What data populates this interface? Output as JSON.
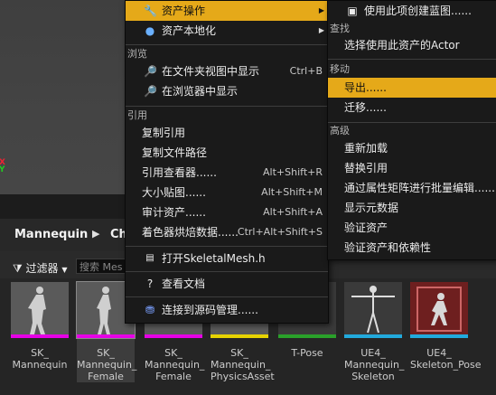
{
  "viewport": {
    "axis_x": "X",
    "axis_y": "Y"
  },
  "breadcrumb": {
    "items": [
      "Mannequin",
      "Ch"
    ]
  },
  "filterbar": {
    "filter_label": "过滤器",
    "search_placeholder": "搜索 Mes"
  },
  "assets": [
    {
      "label": "SK_\nMannequin",
      "bar_color": "#e600e6"
    },
    {
      "label": "SK_\nMannequin_\nFemale",
      "bar_color": "#e600e6"
    },
    {
      "label": "SK_\nMannequin_\nFemale",
      "bar_color": "#e600e6"
    },
    {
      "label": "SK_\nMannequin_\nPhysicsAsset",
      "bar_color": "#e6d200"
    },
    {
      "label": "T-Pose",
      "bar_color": "#2aa02a"
    },
    {
      "label": "UE4_\nMannequin_\nSkeleton",
      "bar_color": "#22aadd"
    },
    {
      "label": "UE4_\nSkeleton_Pose",
      "bar_color": "#22aadd"
    }
  ],
  "main_menu": {
    "asset_actions": "资产操作",
    "asset_localization": "资产本地化",
    "section_browse": "浏览",
    "show_in_folder": "在文件夹视图中显示",
    "show_in_folder_shortcut": "Ctrl+B",
    "show_in_browser": "在浏览器中显示",
    "section_reference": "引用",
    "copy_reference": "复制引用",
    "copy_file_path": "复制文件路径",
    "reference_viewer": "引用查看器......",
    "reference_viewer_shortcut": "Alt+Shift+R",
    "size_map": "大小贴图......",
    "size_map_shortcut": "Alt+Shift+M",
    "audit_assets": "审计资产......",
    "audit_assets_shortcut": "Alt+Shift+A",
    "shader_cook": "着色器烘焙数据......",
    "shader_cook_shortcut": "Ctrl+Alt+Shift+S",
    "open_skeletalmesh_h": "打开SkeletalMesh.h",
    "view_docs": "查看文档",
    "connect_source_control": "连接到源码管理......"
  },
  "sub_menu": {
    "create_blueprint": "使用此项创建蓝图......",
    "section_find": "查找",
    "select_actor": "选择使用此资产的Actor",
    "section_move": "移动",
    "export": "导出......",
    "migrate": "迁移......",
    "section_advanced": "高级",
    "reload": "重新加载",
    "replace_references": "替换引用",
    "bulk_edit": "通过属性矩阵进行批量编辑......",
    "show_metadata": "显示元数据",
    "validate_asset": "验证资产",
    "validate_asset_deps": "验证资产和依赖性"
  },
  "colors": {
    "highlight": "#e5a919",
    "menu_bg": "#1a1a1a"
  }
}
